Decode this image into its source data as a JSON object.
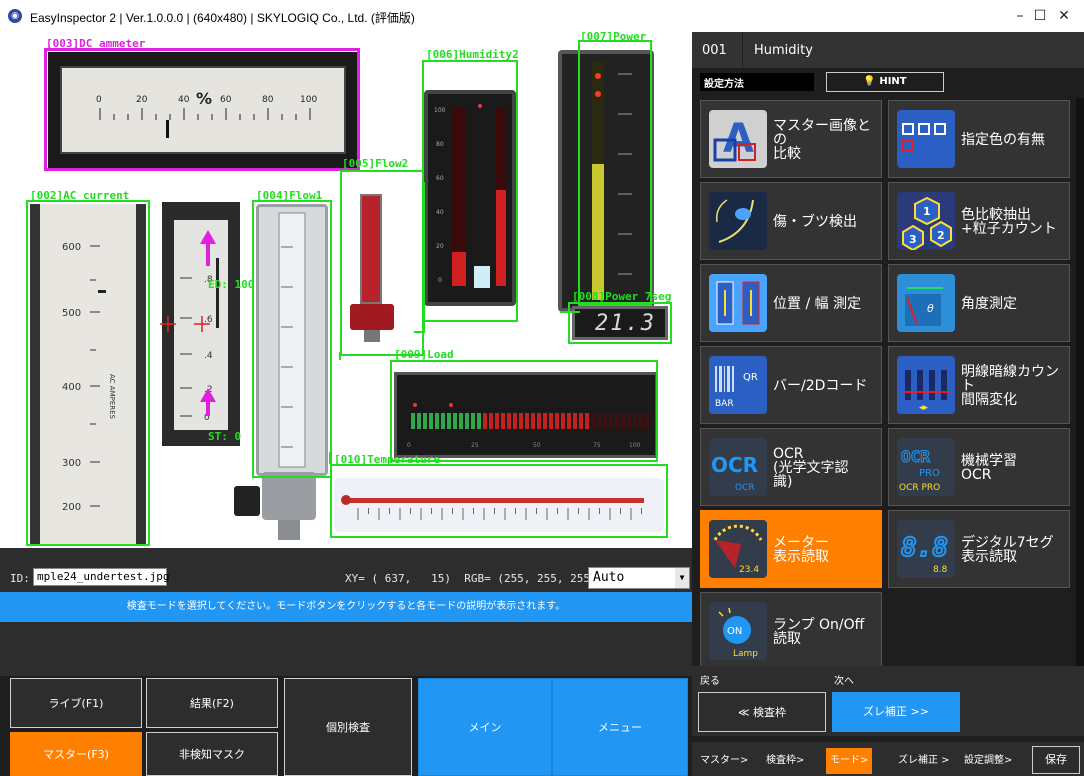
{
  "window": {
    "title": "EasyInspector 2 | Ver.1.0.0.0 | (640x480) | SKYLOGIQ Co., Ltd. (評価版)",
    "minimize": "–",
    "maximize": "☐",
    "close": "✕"
  },
  "viewer": {
    "roi_labels": {
      "dc_ammeter": "[003]DC ammeter",
      "dc_current": "DC current",
      "ac_current": "[002]AC current",
      "flow1": "[004]Flow1",
      "flow2": "[005]Flow2",
      "humidity2": "[006]Humidity2",
      "power": "[007]Power",
      "power_7seg": "[008]Power 7seg",
      "load": "[009]Load",
      "temperature": "[010]Temperature",
      "ed": "ED: 100",
      "st": "ST: 0"
    },
    "seg_display": "21.3"
  },
  "info": {
    "id_label": "ID:",
    "id_value": "mple24_undertest.jpg",
    "xy_rgb": "XY= ( 637,   15)  RGB= (255, 255, 255)",
    "mode_select": "Auto"
  },
  "message": "検査モードを選択してください。モードボタンをクリックすると各モードの説明が表示されます。",
  "bottom_buttons": {
    "live": "ライブ(F1)",
    "result": "結果(F2)",
    "individual": "個別検査",
    "main": "メイン",
    "menu": "メニュー",
    "master": "マスター(F3)",
    "mask": "非検知マスク"
  },
  "right_panel": {
    "item_number": "001",
    "item_name": "Humidity",
    "setting_label": "設定方法",
    "hint_label": "HINT",
    "modes": [
      {
        "label": "マスター画像との\n比較",
        "icon": "master-compare-icon"
      },
      {
        "label": "指定色の有無",
        "icon": "color-presence-icon"
      },
      {
        "label": "傷・ブツ検出",
        "icon": "scratch-detect-icon"
      },
      {
        "label": "色比較抽出\n+粒子カウント",
        "icon": "particle-count-icon"
      },
      {
        "label": "位置 / 幅 測定",
        "icon": "position-width-icon"
      },
      {
        "label": "角度測定",
        "icon": "angle-measure-icon"
      },
      {
        "label": "バー/2Dコード",
        "icon": "barcode-icon"
      },
      {
        "label": "明線暗線カウント\n間隔変化",
        "icon": "line-count-icon"
      },
      {
        "label": "OCR\n(光学文字認\n識)",
        "icon": "ocr-icon"
      },
      {
        "label": "機械学習\nOCR",
        "icon": "ocr-pro-icon"
      },
      {
        "label": "メーター\n表示読取",
        "icon": "meter-read-icon"
      },
      {
        "label": "デジタル7セグ\n表示読取",
        "icon": "seven-seg-icon"
      },
      {
        "label": "ランプ On/Off\n読取",
        "icon": "lamp-icon"
      }
    ],
    "icon_texts": {
      "ocr": "OCR",
      "ocr_small": "OCR",
      "ocr_pro_small": "OCR PRO",
      "pro": "PRO",
      "bar": "BAR",
      "qr": "QR",
      "meter_value": "23.4",
      "seg_big": "8.8",
      "seg_small": "8.8",
      "lamp_on": "ON",
      "lamp": "Lamp"
    },
    "prev_label": "戻る",
    "next_label": "次へ",
    "prev_button": "≪ 検査枠",
    "next_button": "ズレ補正 >>",
    "steps": [
      "マスター>",
      "検査枠>",
      "モード>",
      "ズレ補正 >",
      "設定調整>"
    ],
    "save": "保存"
  },
  "colors": {
    "accent_orange": "#ff7f00",
    "accent_blue": "#2196f3",
    "roi_green": "#22dd22",
    "roi_magenta": "#e020e0"
  }
}
